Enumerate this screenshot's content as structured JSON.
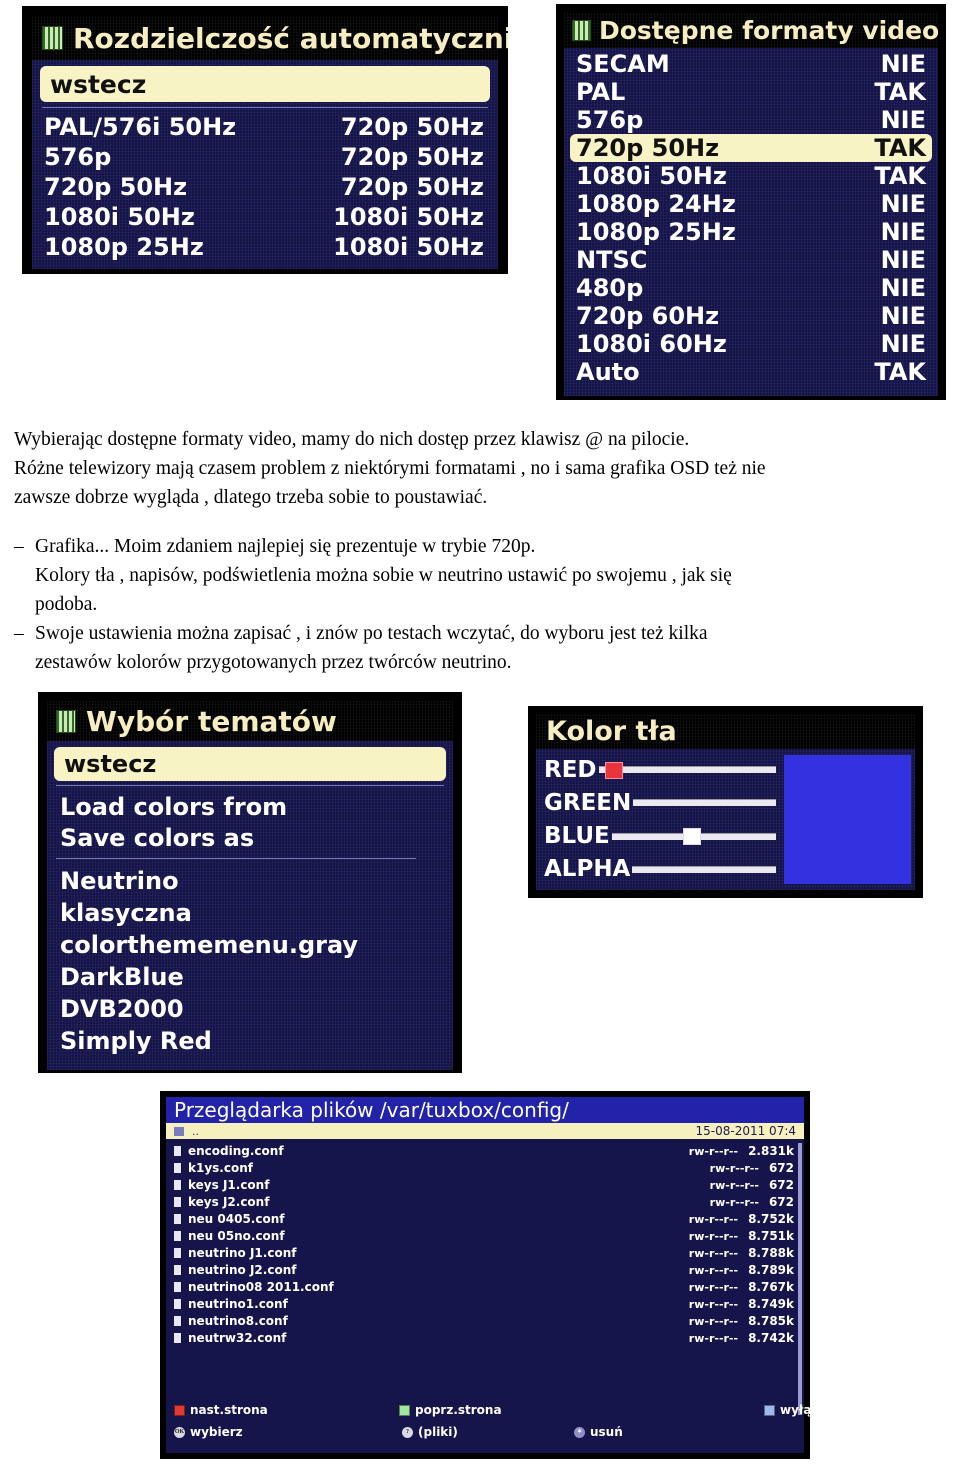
{
  "colors": {
    "osd_title_blue": "#2222a8",
    "osd_body_navy": "#14144a",
    "highlight_cream": "#f7f3c4",
    "title_text": "#f6edc0",
    "slider_red": "#e8343c",
    "preview_blue": "#3232e0"
  },
  "panel_resolution": {
    "icon": "menu-grid-icon",
    "title": "Rozdzielczość  automatycznie",
    "back_label": "wstecz",
    "rows": [
      {
        "left": "PAL/576i 50Hz",
        "right": "720p 50Hz"
      },
      {
        "left": "576p",
        "right": "720p 50Hz"
      },
      {
        "left": "720p 50Hz",
        "right": "720p 50Hz"
      },
      {
        "left": "1080i 50Hz",
        "right": "1080i 50Hz"
      },
      {
        "left": "1080p 25Hz",
        "right": "1080i 50Hz"
      }
    ]
  },
  "panel_formats": {
    "icon": "menu-grid-icon",
    "title": "Dostępne formaty video",
    "rows": [
      {
        "name": "SECAM",
        "value": "NIE",
        "selected": false
      },
      {
        "name": "PAL",
        "value": "TAK",
        "selected": false
      },
      {
        "name": "576p",
        "value": "NIE",
        "selected": false
      },
      {
        "name": "720p 50Hz",
        "value": "TAK",
        "selected": true
      },
      {
        "name": "1080i 50Hz",
        "value": "TAK",
        "selected": false
      },
      {
        "name": "1080p 24Hz",
        "value": "NIE",
        "selected": false
      },
      {
        "name": "1080p 25Hz",
        "value": "NIE",
        "selected": false
      },
      {
        "name": "NTSC",
        "value": "NIE",
        "selected": false
      },
      {
        "name": "480p",
        "value": "NIE",
        "selected": false
      },
      {
        "name": "720p 60Hz",
        "value": "NIE",
        "selected": false
      },
      {
        "name": "1080i 60Hz",
        "value": "NIE",
        "selected": false
      },
      {
        "name": "Auto",
        "value": "TAK",
        "selected": false
      }
    ]
  },
  "prose": {
    "para1": [
      "Wybierając dostępne formaty video, mamy do nich dostęp przez klawisz @ na pilocie.",
      "Różne telewizory mają czasem problem z niektórymi formatami , no i sama grafika OSD też nie",
      "zawsze dobrze wygląda , dlatego trzeba sobie to poustawiać."
    ],
    "bullet1": {
      "marker": "–",
      "lines": [
        "Grafika... Moim zdaniem najlepiej się prezentuje w trybie 720p."
      ]
    },
    "bullet2": {
      "marker": "",
      "lines": [
        "Kolory tła , napisów, podświetlenia można sobie w neutrino ustawić po swojemu , jak się",
        "podoba."
      ]
    },
    "bullet3": {
      "marker": "–",
      "lines": [
        "Swoje ustawienia można zapisać , i znów po testach wczytać, do wyboru jest też kilka",
        "zestawów kolorów przygotowanych przez twórców neutrino."
      ]
    }
  },
  "panel_themes": {
    "icon": "menu-grid-icon",
    "title": "Wybór tematów",
    "back_label": "wstecz",
    "actions": [
      "Load colors from",
      "Save colors as"
    ],
    "themes": [
      "Neutrino",
      "klasyczna",
      "colorthememenu.gray",
      "DarkBlue",
      "DVB2000",
      "Simply Red"
    ]
  },
  "panel_bgcolor": {
    "title": "Kolor tła",
    "sliders": [
      {
        "label": "RED",
        "percent": 8,
        "knob_color": "red"
      },
      {
        "label": "GREEN",
        "percent": 0,
        "knob_color": "none"
      },
      {
        "label": "BLUE",
        "percent": 48,
        "knob_color": "white"
      },
      {
        "label": "ALPHA",
        "percent": 0,
        "knob_color": "none"
      }
    ]
  },
  "panel_filebrowser": {
    "title": "Przeglądarka plików /var/tuxbox/config/",
    "datetime": "15-08-2011 07:4",
    "parent_entry": "..",
    "files": [
      {
        "name": "encoding.conf",
        "perm": "rw-r--r--",
        "size": "2.831k"
      },
      {
        "name": "k1ys.conf",
        "perm": "rw-r--r--",
        "size": "672"
      },
      {
        "name": "keys J1.conf",
        "perm": "rw-r--r--",
        "size": "672"
      },
      {
        "name": "keys J2.conf",
        "perm": "rw-r--r--",
        "size": "672"
      },
      {
        "name": "neu 0405.conf",
        "perm": "rw-r--r--",
        "size": "8.752k"
      },
      {
        "name": "neu 05no.conf",
        "perm": "rw-r--r--",
        "size": "8.751k"
      },
      {
        "name": "neutrino J1.conf",
        "perm": "rw-r--r--",
        "size": "8.788k"
      },
      {
        "name": "neutrino J2.conf",
        "perm": "rw-r--r--",
        "size": "8.789k"
      },
      {
        "name": "neutrino08 2011.conf",
        "perm": "rw-r--r--",
        "size": "8.767k"
      },
      {
        "name": "neutrino1.conf",
        "perm": "rw-r--r--",
        "size": "8.749k"
      },
      {
        "name": "neutrino8.conf",
        "perm": "rw-r--r--",
        "size": "8.785k"
      },
      {
        "name": "neutrw32.conf",
        "perm": "rw-r--r--",
        "size": "8.742k"
      }
    ],
    "footer": [
      {
        "key": "red",
        "label": "nast.strona"
      },
      {
        "key": "green",
        "label": "poprz.strona"
      },
      {
        "key": "blue",
        "label": "wyłącz filtr"
      },
      {
        "key": "ok",
        "label": "wybierz"
      },
      {
        "key": "help",
        "label": "(pliki)"
      },
      {
        "key": "delete",
        "label": "usuń"
      }
    ]
  }
}
